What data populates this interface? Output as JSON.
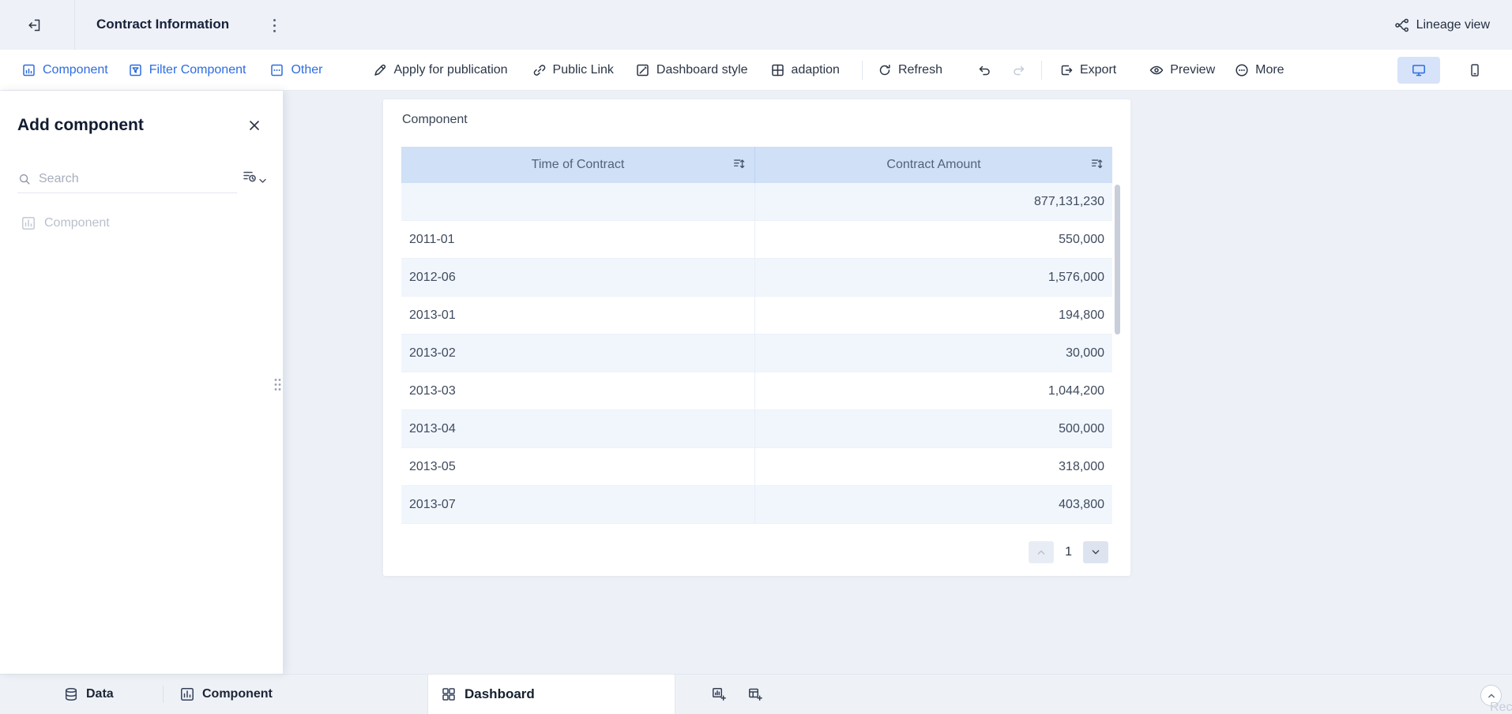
{
  "colors": {
    "accent": "#2e6ce0",
    "table_header_bg": "#cfe0f7",
    "row_stripe": "#f1f6fd"
  },
  "topbar": {
    "title": "Contract Information",
    "lineage": "Lineage view"
  },
  "toolbar": {
    "component": "Component",
    "filter_component": "Filter Component",
    "other": "Other",
    "apply": "Apply for publication",
    "public_link": "Public Link",
    "dashboard_style": "Dashboard style",
    "adaption": "adaption",
    "refresh": "Refresh",
    "export": "Export",
    "preview": "Preview",
    "more": "More"
  },
  "panel": {
    "title": "Add component",
    "search_placeholder": "Search",
    "item": "Component"
  },
  "card": {
    "title": "Component",
    "columns": [
      "Time of Contract",
      "Contract Amount"
    ],
    "rows": [
      [
        "",
        "877,131,230"
      ],
      [
        "2011-01",
        "550,000"
      ],
      [
        "2012-06",
        "1,576,000"
      ],
      [
        "2013-01",
        "194,800"
      ],
      [
        "2013-02",
        "30,000"
      ],
      [
        "2013-03",
        "1,044,200"
      ],
      [
        "2013-04",
        "500,000"
      ],
      [
        "2013-05",
        "318,000"
      ],
      [
        "2013-07",
        "403,800"
      ]
    ],
    "page": "1"
  },
  "bottombar": {
    "data": "Data",
    "component": "Component",
    "dashboard": "Dashboard",
    "record": "Record"
  }
}
